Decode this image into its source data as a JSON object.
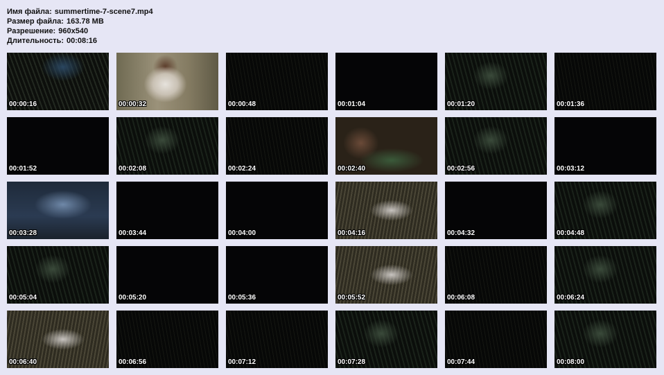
{
  "file_info": {
    "name_label": "Имя файла:",
    "name_value": "summertime-7-scene7.mp4",
    "size_label": "Размер файла:",
    "size_value": "163.78 MB",
    "resolution_label": "Разрешение:",
    "resolution_value": "960x540",
    "duration_label": "Длительность:",
    "duration_value": "00:08:16"
  },
  "thumbnails": [
    {
      "time": "00:00:16",
      "tone": "dark-blue"
    },
    {
      "time": "00:00:32",
      "tone": "bright"
    },
    {
      "time": "00:00:48",
      "tone": "dark"
    },
    {
      "time": "00:01:04",
      "tone": "black"
    },
    {
      "time": "00:01:20",
      "tone": "dark-green"
    },
    {
      "time": "00:01:36",
      "tone": "dark"
    },
    {
      "time": "00:01:52",
      "tone": "black"
    },
    {
      "time": "00:02:08",
      "tone": "dark-green"
    },
    {
      "time": "00:02:24",
      "tone": "dark"
    },
    {
      "time": "00:02:40",
      "tone": "warm"
    },
    {
      "time": "00:02:56",
      "tone": "dark-green"
    },
    {
      "time": "00:03:12",
      "tone": "black"
    },
    {
      "time": "00:03:28",
      "tone": "blue"
    },
    {
      "time": "00:03:44",
      "tone": "black"
    },
    {
      "time": "00:04:00",
      "tone": "black"
    },
    {
      "time": "00:04:16",
      "tone": "grass"
    },
    {
      "time": "00:04:32",
      "tone": "black"
    },
    {
      "time": "00:04:48",
      "tone": "dark-green"
    },
    {
      "time": "00:05:04",
      "tone": "dark-green"
    },
    {
      "time": "00:05:20",
      "tone": "black"
    },
    {
      "time": "00:05:36",
      "tone": "black"
    },
    {
      "time": "00:05:52",
      "tone": "grass"
    },
    {
      "time": "00:06:08",
      "tone": "dark"
    },
    {
      "time": "00:06:24",
      "tone": "dark-green"
    },
    {
      "time": "00:06:40",
      "tone": "grass"
    },
    {
      "time": "00:06:56",
      "tone": "dark"
    },
    {
      "time": "00:07:12",
      "tone": "dark"
    },
    {
      "time": "00:07:28",
      "tone": "dark-green"
    },
    {
      "time": "00:07:44",
      "tone": "dark"
    },
    {
      "time": "00:08:00",
      "tone": "dark-green"
    }
  ],
  "tone_colors": {
    "black": "#050506",
    "dark": "#0d0f0c",
    "dark-blue": "#14202c",
    "dark-green": "#15201a",
    "bright": "#8a7f6a",
    "warm": "#2a2218",
    "blue": "#2b3b52",
    "grass": "#3e3a2c"
  }
}
